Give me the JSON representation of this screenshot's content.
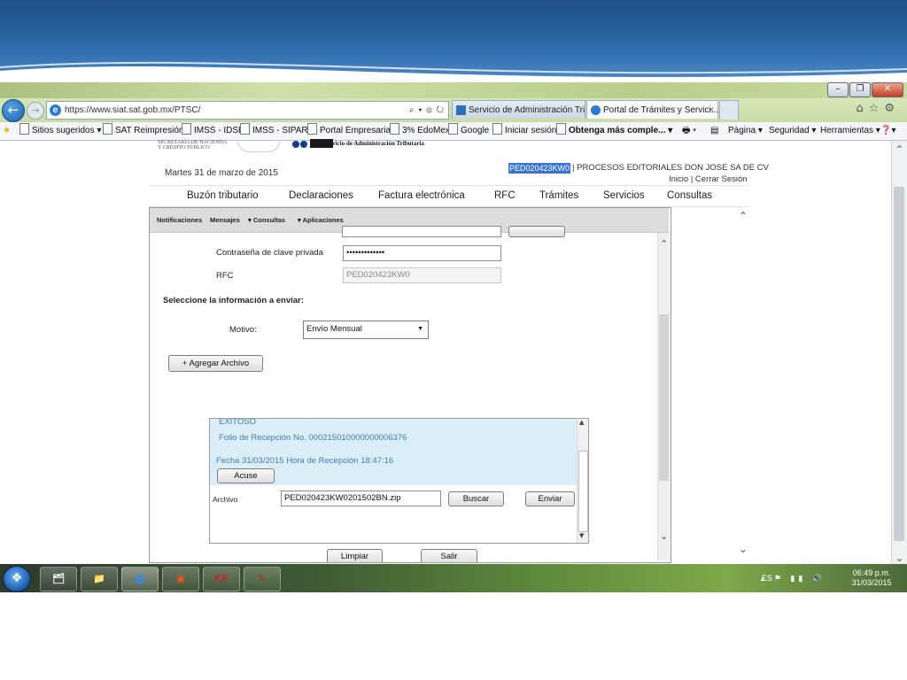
{
  "browser": {
    "url": "https://www.siat.sat.gob.mx/PTSC/",
    "tabs": [
      {
        "label": "Servicio de Administración Tri..."
      },
      {
        "label": "Portal de Trámites y Servici...",
        "close": "×"
      }
    ],
    "favorites": [
      {
        "label": "Sitios sugeridos ▾"
      },
      {
        "label": "SAT Reimpresión"
      },
      {
        "label": "IMSS - IDSE"
      },
      {
        "label": "IMSS - SIPARE"
      },
      {
        "label": "Portal Empresarial"
      },
      {
        "label": "3% EdoMex"
      },
      {
        "label": "Google"
      },
      {
        "label": "Iniciar sesión"
      },
      {
        "label": "Obtenga más comple... ▾"
      }
    ],
    "commands": {
      "page": "Página ▾",
      "security": "Seguridad ▾",
      "tools": "Herramientas ▾"
    }
  },
  "header": {
    "agency_lines": [
      "SECRETARÍA DE HACIENDA",
      "Y CRÉDITO PÚBLICO"
    ],
    "sat_subtitle": "Servicio de Administración Tributaria",
    "date": "Martes 31 de marzo de 2015",
    "rfc": "PED020423KW0",
    "company": " | PROCESOS EDITORIALES DON JOSE SA DE CV",
    "links": "Inicio | Cerrar Sesión"
  },
  "menu": [
    "Buzón tributario",
    "Declaraciones",
    "Factura electrónica",
    "RFC",
    "Trámites",
    "Servicios",
    "Consultas"
  ],
  "subnav": [
    "Notificaciones",
    "Mensajes",
    "▾ Consultas",
    "▾ Aplicaciones"
  ],
  "form": {
    "password_label": "Contraseña de clave privada",
    "password_value": "•••••••••••••",
    "rfc_label": "RFC",
    "rfc_value": "PED020423KW0",
    "section_title": "Seleccione la información a enviar:",
    "motivo_label": "Motivo:",
    "motivo_value": "Envío Mensual",
    "add_file_button": "+ Agregar Archivo"
  },
  "upload": {
    "status": "EXITOSO",
    "folio": "Folio de Recepción No. 000215010000000006376",
    "date_line": "Fecha 31/03/2015 Hora de Recepción 18:47:16",
    "acuse_button": "Acuse",
    "file_label": "Archivo",
    "file_value": "PED020423KW0201502BN.zip",
    "search_button": "Buscar",
    "send_button": "Enviar"
  },
  "actions": {
    "clear_button": "Limpiar",
    "exit_button": "Salir"
  },
  "taskbar": {
    "icons": [
      "folder-icon",
      "explorer-icon",
      "internet-explorer-icon",
      "presentation-icon",
      "coldfusion-icon",
      "pdf-icon"
    ],
    "icon_glyphs": [
      "🗂",
      "📁",
      "e",
      "▣",
      "CF",
      "✎"
    ],
    "lang": "ES",
    "time": "06:49 p.m.",
    "date": "31/03/2015"
  }
}
